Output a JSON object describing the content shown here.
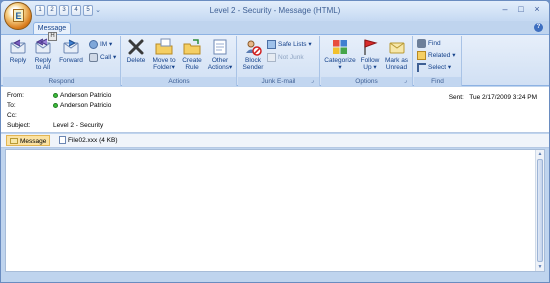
{
  "window": {
    "title": "Level 2 - Security - Message (HTML)",
    "minimize": "–",
    "maximize": "□",
    "close": "×",
    "quick_access": [
      "1",
      "2",
      "3",
      "4",
      "5"
    ],
    "quick_access_more": "⌄"
  },
  "office_button": {
    "glyph": "E"
  },
  "ribbon": {
    "tab_label": "Message",
    "keytip": "H",
    "help": "?",
    "groups": {
      "respond": {
        "label": "Respond",
        "reply": "Reply",
        "reply_all_1": "Reply",
        "reply_all_2": "to All",
        "forward": "Forward",
        "im": "IM",
        "call": "Call"
      },
      "actions": {
        "label": "Actions",
        "delete": "Delete",
        "move_1": "Move to",
        "move_2": "Folder",
        "rule_1": "Create",
        "rule_2": "Rule",
        "other_1": "Other",
        "other_2": "Actions"
      },
      "junk": {
        "label": "Junk E-mail",
        "block_1": "Block",
        "block_2": "Sender",
        "safe_lists": "Safe Lists",
        "not_junk": "Not Junk"
      },
      "options": {
        "label": "Options",
        "categorize": "Categorize",
        "follow_1": "Follow",
        "follow_2": "Up",
        "mark_1": "Mark as",
        "mark_2": "Unread"
      },
      "find": {
        "label": "Find",
        "find": "Find",
        "related": "Related",
        "select": "Select"
      }
    },
    "dropdown_glyph": "▾",
    "launcher_glyph": "⌟"
  },
  "message": {
    "from_label": "From:",
    "from_value": "Anderson Patricio",
    "to_label": "To:",
    "to_value": "Anderson Patricio",
    "cc_label": "Cc:",
    "cc_value": "",
    "subject_label": "Subject:",
    "subject_value": "Level 2 - Security",
    "sent_label": "Sent:",
    "sent_value": "Tue 2/17/2009 3:24 PM"
  },
  "attachments": {
    "message_tab": "Message",
    "file": "File02.xxx (4 KB)"
  },
  "body": {
    "text": "",
    "scroll_up": "▲",
    "scroll_down": "▼"
  },
  "colors": {
    "ribbon_bg": "#d1e0f4",
    "title_text": "#3e5f94",
    "active_attachment": "#fbe2a2",
    "presence_online": "#3bbf3b"
  }
}
